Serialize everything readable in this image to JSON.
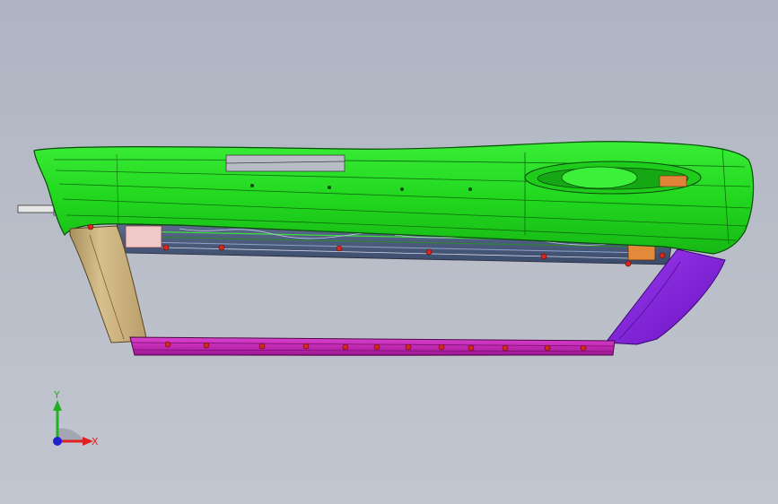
{
  "viewport": {
    "background_top": "#aeb4c2",
    "background_bottom": "#c2c6d0"
  },
  "parts": {
    "upper_panel_color": "#22e01f",
    "left_bracket_color": "#c8b07e",
    "right_bracket_color": "#8a2be2",
    "lower_rail_color": "#c426b8",
    "fastener_color": "#d42a1e",
    "shaft_color": "#e8e8e8"
  },
  "triad": {
    "y_label": "Y",
    "x_label": "X",
    "y_color": "#22b022",
    "x_color": "#e02020",
    "z_color": "#2020d0"
  }
}
